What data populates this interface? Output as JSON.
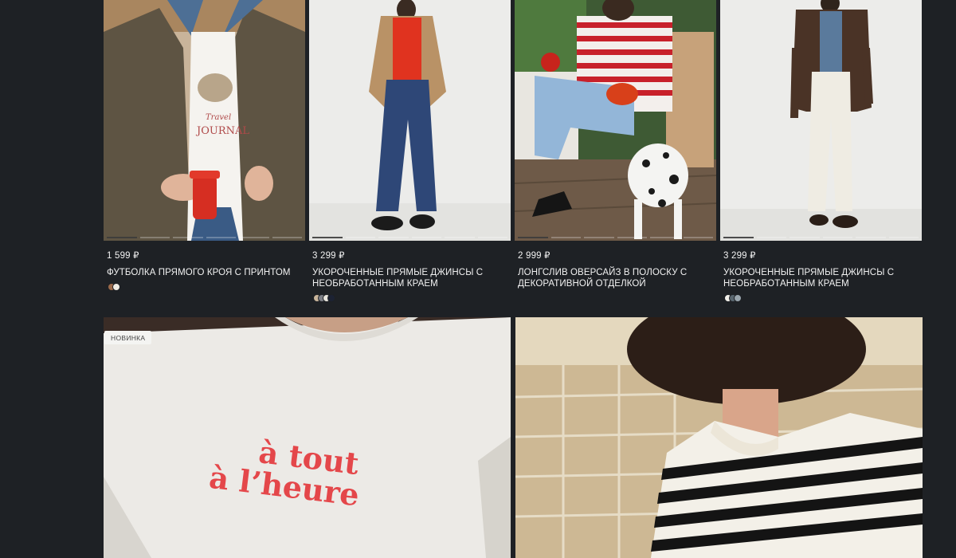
{
  "currency": "₽",
  "products": [
    {
      "price": "1 599 ₽",
      "name": "ФУТБОЛКА ПРЯМОГО КРОЯ С ПРИНТОМ",
      "swatches": [
        "#9b6a4a",
        "#f0ece4"
      ],
      "tee_print_line1": "Travel",
      "tee_print_line2": "JOURNAL"
    },
    {
      "price": "3 299 ₽",
      "name": "УКОРОЧЕННЫЕ ПРЯМЫЕ ДЖИНСЫ С НЕОБРАБОТАННЫМ КРАЕМ",
      "swatches": [
        "#c9b59b",
        "#7d7f86",
        "#e9e6de",
        "#1c2233"
      ]
    },
    {
      "price": "2 999 ₽",
      "name": "ЛОНГСЛИВ ОВЕРСАЙЗ В ПОЛОСКУ С ДЕКОРАТИВНОЙ ОТДЕЛКОЙ",
      "swatches": []
    },
    {
      "price": "3 299 ₽",
      "name": "УКОРОЧЕННЫЕ ПРЯМЫЕ ДЖИНСЫ С НЕОБРАБОТАННЫМ КРАЕМ",
      "swatches": [
        "#f2f0ea",
        "#5a6770",
        "#9aa6ae"
      ]
    }
  ],
  "promo": {
    "badge": "НОВИНКА",
    "tee_text_line1": "à tout",
    "tee_text_line2": "à l’heure"
  },
  "colors": {
    "page_background": "#1e2125",
    "print_red": "#e4474a"
  }
}
